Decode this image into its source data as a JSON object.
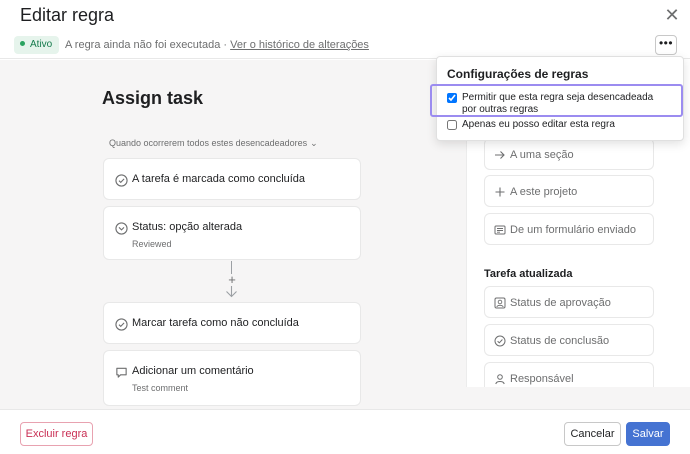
{
  "header": {
    "title": "Editar regra"
  },
  "status": {
    "badge": "Ativo",
    "text": "A regra ainda não foi executada · ",
    "link": "Ver o histórico de alterações"
  },
  "rule": {
    "name": "Assign task",
    "trigger_label": "Quando ocorrerem todos estes desencadeadores",
    "triggers": [
      {
        "label": "A tarefa é marcada como concluída",
        "icon": "check-circle-icon"
      },
      {
        "label": "Status: opção alterada",
        "sub": "Reviewed",
        "icon": "chevron-circle-icon"
      }
    ],
    "actions": [
      {
        "label": "Marcar tarefa como não concluída",
        "icon": "check-circle-icon"
      },
      {
        "label": "Adicionar um comentário",
        "sub": "Test comment",
        "icon": "comment-icon"
      }
    ]
  },
  "panel": {
    "options_top": [
      {
        "label": "A uma seção",
        "icon": "arrow-right-icon"
      },
      {
        "label": "A este projeto",
        "icon": "plus-icon"
      },
      {
        "label": "De um formulário enviado",
        "icon": "form-icon"
      }
    ],
    "section_title": "Tarefa atualizada",
    "options_updated": [
      {
        "label": "Status de aprovação",
        "icon": "approval-icon"
      },
      {
        "label": "Status de conclusão",
        "icon": "check-circle-icon"
      },
      {
        "label": "Responsável",
        "icon": "person-icon"
      }
    ]
  },
  "dropdown": {
    "title": "Configurações de regras",
    "options": [
      {
        "label": "Permitir que esta regra seja desencadeada por outras regras",
        "checked": true
      },
      {
        "label": "Apenas eu posso editar esta regra",
        "checked": false
      }
    ]
  },
  "footer": {
    "delete_label": "Excluir regra",
    "cancel_label": "Cancelar",
    "save_label": "Salvar"
  },
  "colors": {
    "accent": "#4573d2",
    "danger": "#c92f54",
    "active": "#2aa360",
    "highlight": "#9b8cf0"
  }
}
